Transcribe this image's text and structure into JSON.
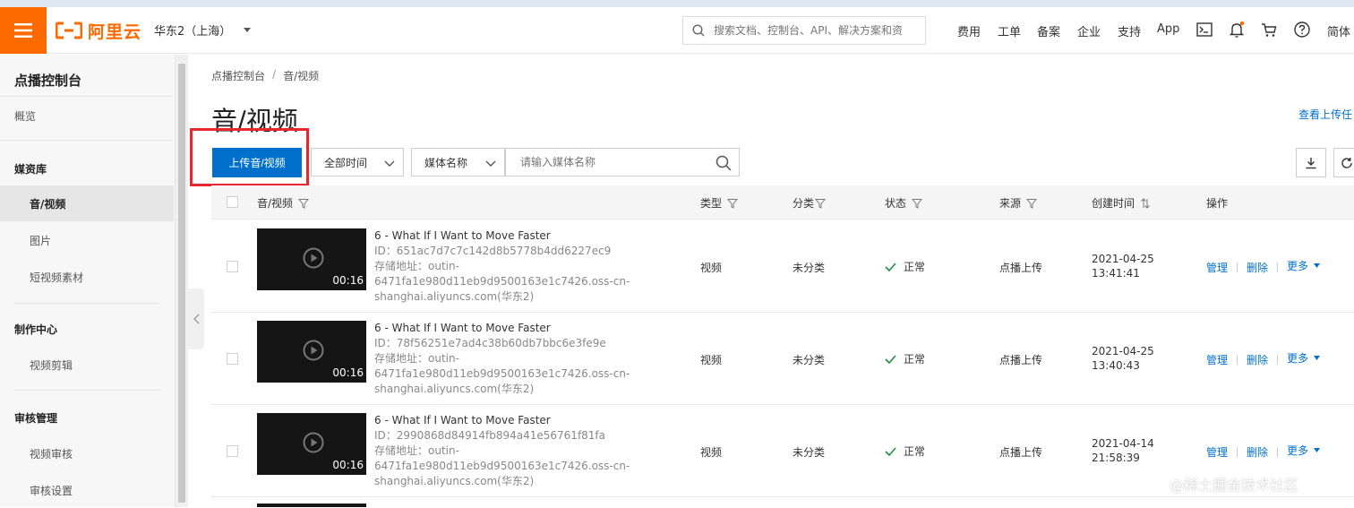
{
  "header": {
    "logo_text": "阿里云",
    "region": "华东2（上海）",
    "search_placeholder": "搜索文档、控制台、API、解决方案和资",
    "links": [
      "费用",
      "工单",
      "备案",
      "企业",
      "支持",
      "App"
    ],
    "lang": "简体",
    "icons": [
      "terminal-icon",
      "bell-icon",
      "cart-icon",
      "help-icon"
    ],
    "brand_color": "#ff6a00"
  },
  "sidebar": {
    "title": "点播控制台",
    "overview": "概览",
    "group_media": "媒资库",
    "item_av": "音/视频",
    "item_image": "图片",
    "item_short": "短视频素材",
    "group_production": "制作中心",
    "item_edit": "视频剪辑",
    "group_review": "审核管理",
    "item_review": "视频审核",
    "item_review_settings": "审核设置"
  },
  "breadcrumb": {
    "root": "点播控制台",
    "sep": "/",
    "current": "音/视频"
  },
  "page": {
    "title": "音/视频",
    "view_upload_link": "查看上传任"
  },
  "toolbar": {
    "upload_label": "上传音/视频",
    "time_filter": "全部时间",
    "field_filter": "媒体名称",
    "search_placeholder": "请输入媒体名称",
    "accent_color": "#0070cc"
  },
  "table": {
    "headers": {
      "media": "音/视频",
      "type": "类型",
      "category": "分类",
      "status": "状态",
      "source": "来源",
      "created": "创建时间",
      "actions": "操作"
    },
    "rows": [
      {
        "title": "6 - What If I Want to Move Faster",
        "id": "ID：651ac7d7c7c142d8b5778b4dd6227ec9",
        "addr_label": "存储地址：outin-",
        "addr_line2": "6471fa1e980d11eb9d9500163e1c7426.oss-cn-",
        "addr_line3": "shanghai.aliyuncs.com(华东2)",
        "duration": "00:16",
        "type": "视频",
        "category": "未分类",
        "status": "正常",
        "source": "点播上传",
        "date": "2021-04-25",
        "time": "13:41:41",
        "action_manage": "管理",
        "action_delete": "删除",
        "action_more": "更多"
      },
      {
        "title": "6 - What If I Want to Move Faster",
        "id": "ID：78f56251e7ad4c38b60db7bbc6e3fe9e",
        "addr_label": "存储地址：outin-",
        "addr_line2": "6471fa1e980d11eb9d9500163e1c7426.oss-cn-",
        "addr_line3": "shanghai.aliyuncs.com(华东2)",
        "duration": "00:16",
        "type": "视频",
        "category": "未分类",
        "status": "正常",
        "source": "点播上传",
        "date": "2021-04-25",
        "time": "13:40:43",
        "action_manage": "管理",
        "action_delete": "删除",
        "action_more": "更多"
      },
      {
        "title": "6 - What If I Want to Move Faster",
        "id": "ID：2990868d84914fb894a41e56761f81fa",
        "addr_label": "存储地址：outin-",
        "addr_line2": "6471fa1e980d11eb9d9500163e1c7426.oss-cn-",
        "addr_line3": "shanghai.aliyuncs.com(华东2)",
        "duration": "00:16",
        "type": "视频",
        "category": "未分类",
        "status": "正常",
        "source": "点播上传",
        "date": "2021-04-14",
        "time": "21:58:39",
        "action_manage": "管理",
        "action_delete": "删除",
        "action_more": "更多"
      }
    ]
  },
  "watermark": "@稀土掘金技术社区"
}
